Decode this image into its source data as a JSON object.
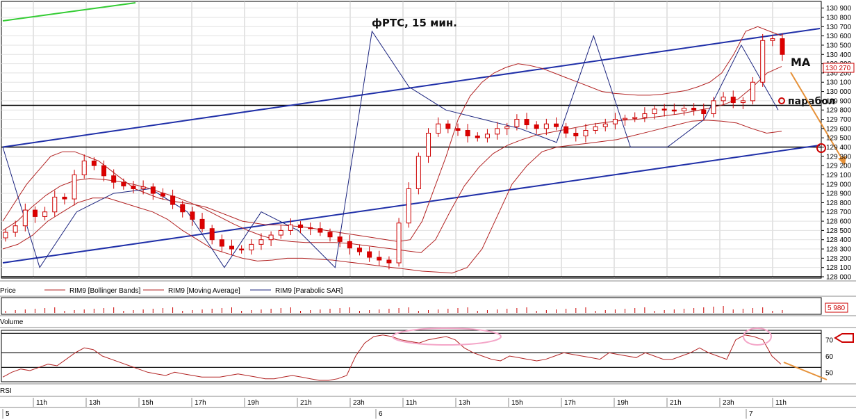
{
  "chart_data": {
    "type": "candlestick",
    "title": "фРТС,  15 мин.",
    "price_axis": {
      "ylim": [
        128000,
        130950
      ],
      "ticks": [
        128000,
        128100,
        128200,
        128300,
        128400,
        128500,
        128600,
        128700,
        128800,
        128900,
        129000,
        129100,
        129200,
        129300,
        129400,
        129500,
        129600,
        129700,
        129800,
        129900,
        130000,
        130100,
        130200,
        130300,
        130400,
        130500,
        130600,
        130700,
        130800,
        130900
      ],
      "tick_labels": [
        "128 000",
        "128 100",
        "128 200",
        "128 300",
        "128 400",
        "128 500",
        "128 600",
        "128 700",
        "128 800",
        "128 900",
        "129 000",
        "129 100",
        "129 200",
        "129 300",
        "129 400",
        "129 500",
        "129 600",
        "129 700",
        "129 800",
        "129 900",
        "130 000",
        "130 100",
        "130 200",
        "130 300",
        "130 400",
        "130 500",
        "130 600",
        "130 700",
        "130 800",
        "130 900"
      ],
      "last_price_label": "130 270",
      "last_price": 130270
    },
    "legend": [
      {
        "label": "Price",
        "color": "#cc0000"
      },
      {
        "label": "RIM9 [Bollinger Bands]",
        "color": "#b22222"
      },
      {
        "label": "RIM9 [Moving Average]",
        "color": "#b22222"
      },
      {
        "label": "RIM9 [Parabolic SAR]",
        "color": "#1a237e"
      }
    ],
    "candles_close": [
      128480,
      128550,
      128720,
      128650,
      128700,
      128860,
      128840,
      129100,
      129250,
      129200,
      129090,
      129020,
      128980,
      128950,
      128970,
      128900,
      128870,
      128780,
      128700,
      128620,
      128520,
      128400,
      128330,
      128300,
      128290,
      128350,
      128400,
      128450,
      128500,
      128560,
      128530,
      128520,
      128480,
      128430,
      128380,
      128310,
      128270,
      128210,
      128180,
      128150,
      128580,
      128950,
      129300,
      129550,
      129650,
      129600,
      129580,
      129520,
      129500,
      129540,
      129600,
      129620,
      129700,
      129640,
      129600,
      129650,
      129620,
      129550,
      129520,
      129580,
      129620,
      129650,
      129700,
      129710,
      129720,
      129760,
      129810,
      129800,
      129790,
      129820,
      129800,
      129760,
      129900,
      129940,
      129880,
      129900,
      130100,
      130550,
      130570,
      130400
    ],
    "bollinger_upper": [
      128600,
      128800,
      129000,
      129150,
      129300,
      129350,
      129350,
      129300,
      129250,
      129150,
      129050,
      128950,
      128900,
      128850,
      128820,
      128800,
      128780,
      128750,
      128700,
      128650,
      128600,
      128580,
      128560,
      128560,
      128550,
      128540,
      128520,
      128500,
      128480,
      128460,
      128440,
      128420,
      128400,
      128380,
      128400,
      128600,
      128950,
      129300,
      129700,
      129950,
      130100,
      130200,
      130260,
      130300,
      130280,
      130250,
      130200,
      130150,
      130100,
      130050,
      130000,
      129980,
      129970,
      129960,
      129960,
      129970,
      129990,
      130010,
      130050,
      130100,
      130200,
      130400,
      130650,
      130700,
      130650,
      130600
    ],
    "moving_average": [
      128500,
      128600,
      128750,
      128880,
      128980,
      129040,
      129060,
      129050,
      129030,
      129000,
      128960,
      128910,
      128860,
      128800,
      128730,
      128650,
      128570,
      128500,
      128440,
      128400,
      128380,
      128370,
      128370,
      128370,
      128360,
      128340,
      128320,
      128300,
      128280,
      128260,
      128400,
      128700,
      128980,
      129180,
      129330,
      129420,
      129480,
      129530,
      129560,
      129590,
      129620,
      129650,
      129670,
      129690,
      129700,
      129720,
      129740,
      129760,
      129790,
      129820,
      129860,
      129920,
      130050,
      130200,
      130270
    ],
    "bollinger_lower": [
      128300,
      128350,
      128450,
      128600,
      128700,
      128800,
      128850,
      128850,
      128800,
      128750,
      128700,
      128620,
      128500,
      128400,
      128300,
      128250,
      128200,
      128170,
      128180,
      128200,
      128200,
      128190,
      128180,
      128160,
      128140,
      128120,
      128100,
      128080,
      128060,
      128050,
      128040,
      128100,
      128300,
      128650,
      129000,
      129200,
      129350,
      129400,
      129420,
      129440,
      129460,
      129480,
      129520,
      129560,
      129600,
      129640,
      129680,
      129690,
      129680,
      129660,
      129600,
      129550,
      129570
    ],
    "parabolic_sar_ref": [
      129400,
      128100,
      128700,
      128900,
      128950,
      128700,
      128100,
      128700,
      128500,
      128100,
      130650,
      130050,
      129800,
      129700,
      129600,
      129450,
      130600,
      129400,
      129400,
      129700,
      130500,
      129800
    ],
    "channel_upper": {
      "from": [
        0,
        129400
      ],
      "to": [
        1,
        130680
      ]
    },
    "channel_lower": {
      "from": [
        0,
        128150
      ],
      "to": [
        1,
        129420
      ]
    },
    "horizontal_levels": [
      129850,
      129400,
      128000
    ],
    "volume": {
      "label": "Volume",
      "last_value_label": "5 980"
    },
    "rsi": {
      "label": "RSI",
      "ylim": [
        45,
        75
      ],
      "tick_labels": [
        "70",
        "60",
        "50"
      ],
      "ticks": [
        70,
        60,
        50
      ],
      "levels": [
        74,
        62,
        53
      ],
      "values": [
        47,
        50,
        52,
        51,
        53,
        55,
        54,
        58,
        62,
        65,
        64,
        60,
        58,
        56,
        54,
        52,
        50,
        49,
        48,
        50,
        49,
        48,
        47,
        47,
        47,
        48,
        49,
        48,
        47,
        46,
        46,
        47,
        48,
        47,
        46,
        45,
        45,
        46,
        48,
        60,
        68,
        72,
        73,
        72,
        70,
        69,
        68,
        70,
        71,
        72,
        70,
        65,
        62,
        60,
        58,
        57,
        60,
        59,
        58,
        57,
        58,
        60,
        62,
        61,
        60,
        59,
        58,
        62,
        61,
        60,
        59,
        62,
        60,
        58,
        58,
        60,
        62,
        65,
        62,
        60,
        58,
        70,
        73,
        72,
        70,
        60,
        55
      ]
    },
    "time_axis": {
      "tick_labels": [
        "11h",
        "13h",
        "15h",
        "17h",
        "19h",
        "21h",
        "23h",
        "11h",
        "13h",
        "15h",
        "17h",
        "19h",
        "21h",
        "23h",
        "11h"
      ],
      "day_labels": [
        "5",
        "6",
        "7"
      ]
    },
    "annotations": [
      "MA",
      "парабол"
    ]
  }
}
